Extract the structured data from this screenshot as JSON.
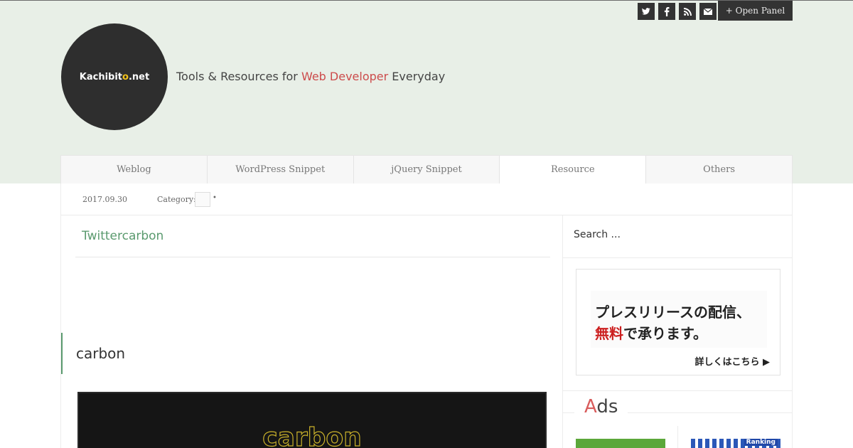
{
  "header": {
    "social_icons": [
      "twitter-icon",
      "facebook-icon",
      "rss-icon",
      "mail-icon"
    ],
    "open_panel_label": "+ Open Panel",
    "logo": {
      "prefix": "Kachibit",
      "accent": "o",
      "suffix": ".net"
    },
    "tagline": {
      "before": "Tools & Resources for ",
      "highlight": "Web Developer",
      "after": " Everyday"
    }
  },
  "nav": {
    "tabs": [
      {
        "label": "Weblog"
      },
      {
        "label": "WordPress Snippet"
      },
      {
        "label": "jQuery Snippet"
      },
      {
        "label": "Resource",
        "active": true
      },
      {
        "label": "Others"
      }
    ]
  },
  "meta": {
    "date": "2017.09.30",
    "category_label": "Category:",
    "bullet": "•"
  },
  "post": {
    "title": "Twittercarbon",
    "heading": "carbon",
    "screenshot_text": "carbon"
  },
  "sidebar": {
    "search_placeholder": "Search ...",
    "banner": {
      "line1": "プレスリリースの配信、",
      "line2_red": "無料",
      "line2_rest": "で承ります。",
      "more": "詳しくはこちら ▶"
    },
    "ads_heading_first": "A",
    "ads_heading_rest": "ds",
    "ad_ranking_label": "Ranking"
  },
  "colors": {
    "accent_green": "#5a9a6e",
    "accent_red": "#cc4b4b",
    "logo_dot": "#f2c21b",
    "header_bg": "#e8efe7"
  }
}
